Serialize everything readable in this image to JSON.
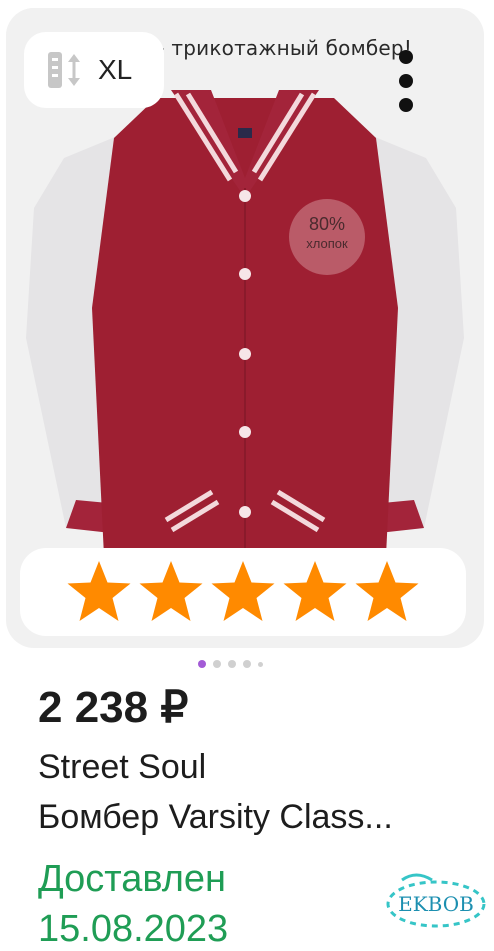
{
  "product_image": {
    "caption": "р - трикотажный бомбер!",
    "fabric_percent": "80%",
    "fabric_material": "хлопок"
  },
  "size_badge": {
    "icon": "size-arrows-icon",
    "label": "XL"
  },
  "menu": {
    "icon": "more-vertical-icon"
  },
  "rating": {
    "stars": 5,
    "max": 5,
    "star_color": "#ff8a00"
  },
  "pager": {
    "total": 5,
    "active_index": 0,
    "active_color": "#a35bd6"
  },
  "price": "2 238 ₽",
  "brand": "Street Soul",
  "title": "Бомбер Varsity Class...",
  "delivery": {
    "status": "Доставлен",
    "date": "15.08.2023",
    "color": "#1f9d55"
  },
  "watermark": "EKBOB"
}
